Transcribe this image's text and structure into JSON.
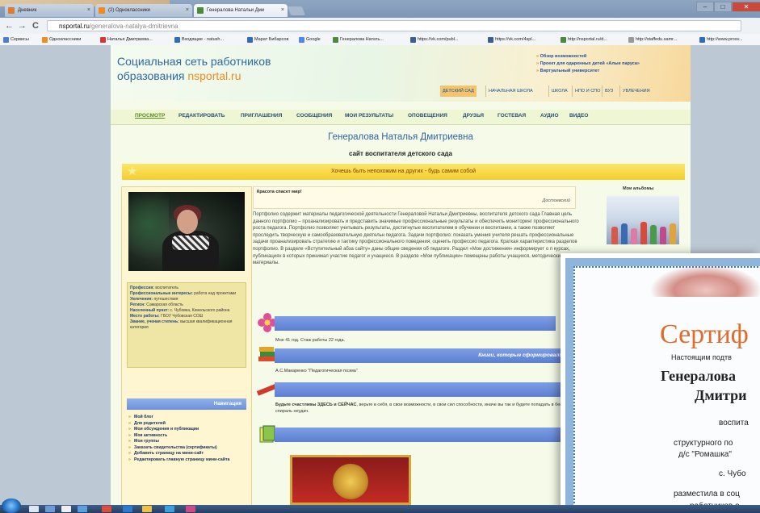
{
  "browser": {
    "tabs": [
      {
        "label": "Дневник",
        "icon_color": "#e07a2c",
        "active": false
      },
      {
        "label": "(2) Одноклассники",
        "icon_color": "#f28a1c",
        "active": false
      },
      {
        "label": "Генералова Натальи Дми",
        "icon_color": "#4b8a3a",
        "active": true
      }
    ],
    "close_tab": "×",
    "back": "←",
    "forward": "→",
    "reload": "C",
    "url_host": "nsportal.ru",
    "url_path": "/generalova-natalya-dmitrievna",
    "window_controls": {
      "minimize": "–",
      "maximize": "□",
      "close": "✕"
    },
    "bookmarks": [
      {
        "label": "Сервисы",
        "color": "#4f7fd0"
      },
      {
        "label": "Одноклассники",
        "color": "#f28a1c"
      },
      {
        "label": "Наталья Дмитриева...",
        "color": "#d33"
      },
      {
        "label": "Входящие - natush...",
        "color": "#2d6fbf"
      },
      {
        "label": "Марат Бибарсов",
        "color": "#2d6fbf"
      },
      {
        "label": "Google",
        "color": "#4a8af0"
      },
      {
        "label": "Генералова Натать...",
        "color": "#4b8a3a"
      },
      {
        "label": "https://vk.com/publ...",
        "color": "#3b5f93"
      },
      {
        "label": "https://vk.com/4spl...",
        "color": "#3b5f93"
      },
      {
        "label": "http://nsportal.ru/d...",
        "color": "#4b8a3a"
      },
      {
        "label": "http://staffedu.samr...",
        "color": "#999"
      },
      {
        "label": "http://www.prosv...",
        "color": "#2d6fbf"
      }
    ]
  },
  "site": {
    "brand_line1": "Социальная сеть работников",
    "brand_line2_prefix": "образования ",
    "brand_domain": "nsportal.ru",
    "header_links": [
      "Обзор возможностей",
      "Проект для одаренных детей «Алые паруса»",
      "Виртуальный университет"
    ],
    "header_nav": [
      "ДЕТСКИЙ САД",
      "НАЧАЛЬНАЯ ШКОЛА",
      "ШКОЛА",
      "НПО И СПО",
      "ВУЗ",
      "УВЛЕЧЕНИЯ"
    ],
    "main_nav": [
      "ПРОСМОТР",
      "РЕДАКТИРОВАТЬ",
      "ПРИГЛАШЕНИЯ",
      "СООБЩЕНИЯ",
      "МОИ РЕЗУЛЬТАТЫ",
      "ОПОВЕЩЕНИЯ",
      "ДРУЗЬЯ",
      "ГОСТЕВАЯ",
      "АУДИО",
      "ВИДЕО"
    ],
    "person_name": "Генералова Наталья Дмитриевна",
    "site_subtitle": "сайт воспитателя детского сада",
    "motto": "Хочешь быть непохожим на других - будь самим собой"
  },
  "profile": {
    "fields": [
      {
        "label": "Профессия:",
        "value": " воспитатель"
      },
      {
        "label": "Профессиональные интересы:",
        "value": " работа над проектами"
      },
      {
        "label": "Увлечения:",
        "value": " путешествия"
      },
      {
        "label": "Регион:",
        "value": " Самарская область"
      },
      {
        "label": "Населенный пункт:",
        "value": " с. Чубовка, Кинельского района"
      },
      {
        "label": "Место работы:",
        "value": " ГБОУ Чубовская СОШ"
      },
      {
        "label": "Звание, ученая степень:",
        "value": " высшая квалификационная категория"
      }
    ]
  },
  "navigation": {
    "title": "Навигация",
    "items": [
      "Мой блог",
      "Для родителей",
      "Мои обсуждения и публикации",
      "Моя активность",
      "Мои группы",
      "Заказать свидетельства (сертификаты)",
      "Добавить страницу на мини-сайт",
      "Редактировать главную страницу мини-сайта"
    ]
  },
  "content": {
    "quote": "Красота спасет мир!",
    "quote_author": "Достоевский",
    "bio": "Портфолио содержит материалы педагогической деятельности Генераловой Натальи Дмитриевны, воспитателя детского сада Главная цель данного портфолио – проанализировать и представить значимые профессиональные результаты и обеспечить мониторинг профессионального роста педагога. Портфолио позволяет учитывать результаты, достигнутые воспитателем в обучении и воспитании, а также позволяет проследить творческую и самообразовательную деятельн педагога. Задачи портфолио: показать умения учителя решать профессиональные задачи проанализировать стратегию и тактику профессионального поведения; оценить профессио педагога. Краткая характеристика разделов портфолио. В разделе «Вступительный абза сайту» даны общие сведения об педагоге. Раздел «Мои достижения» информирует о п курсах, публикациях в которых принимал участие педагог и учащиеся. В разделе «Мои публикации» помещены работы учащихся, методические материалы.",
    "age_text": "Мне 41 год. Стаж работы 22 года.",
    "books_bar": "Книги, которые сформировали мой внутр",
    "books_text": "А.С.Макаренко \"Педагогическая поэма\"",
    "views_bar": "Мой взгл",
    "views_text_bold": "Будьте счастливы ЗДЕСЬ и СЕЙЧАС",
    "views_text_rest": ", верьте в себя, в свои возможности, в свои сил способности, иначе вы так и будете попадать в бесконечную спираль неудач.",
    "docs_bar": "Мои до"
  },
  "albums": {
    "title": "Мои альбомы"
  },
  "certificate": {
    "title": "Сертиф",
    "line1": "Настоящим подтв",
    "name_line1": "Генералова",
    "name_line2": "Дмитри",
    "role": "воспита",
    "unit": "структурного по",
    "kindergarten": "д/с \"Ромашка\"",
    "village": "с. Чубо",
    "posted": "разместила в соц",
    "workers": "работников о"
  },
  "colors": {
    "link_blue": "#2b6a9e",
    "brand_orange": "#f08a1e",
    "motto_yellow": "#f5cd2d",
    "section_bar_blue": "#6d8fdc",
    "certificate_title": "#e06b2a"
  }
}
